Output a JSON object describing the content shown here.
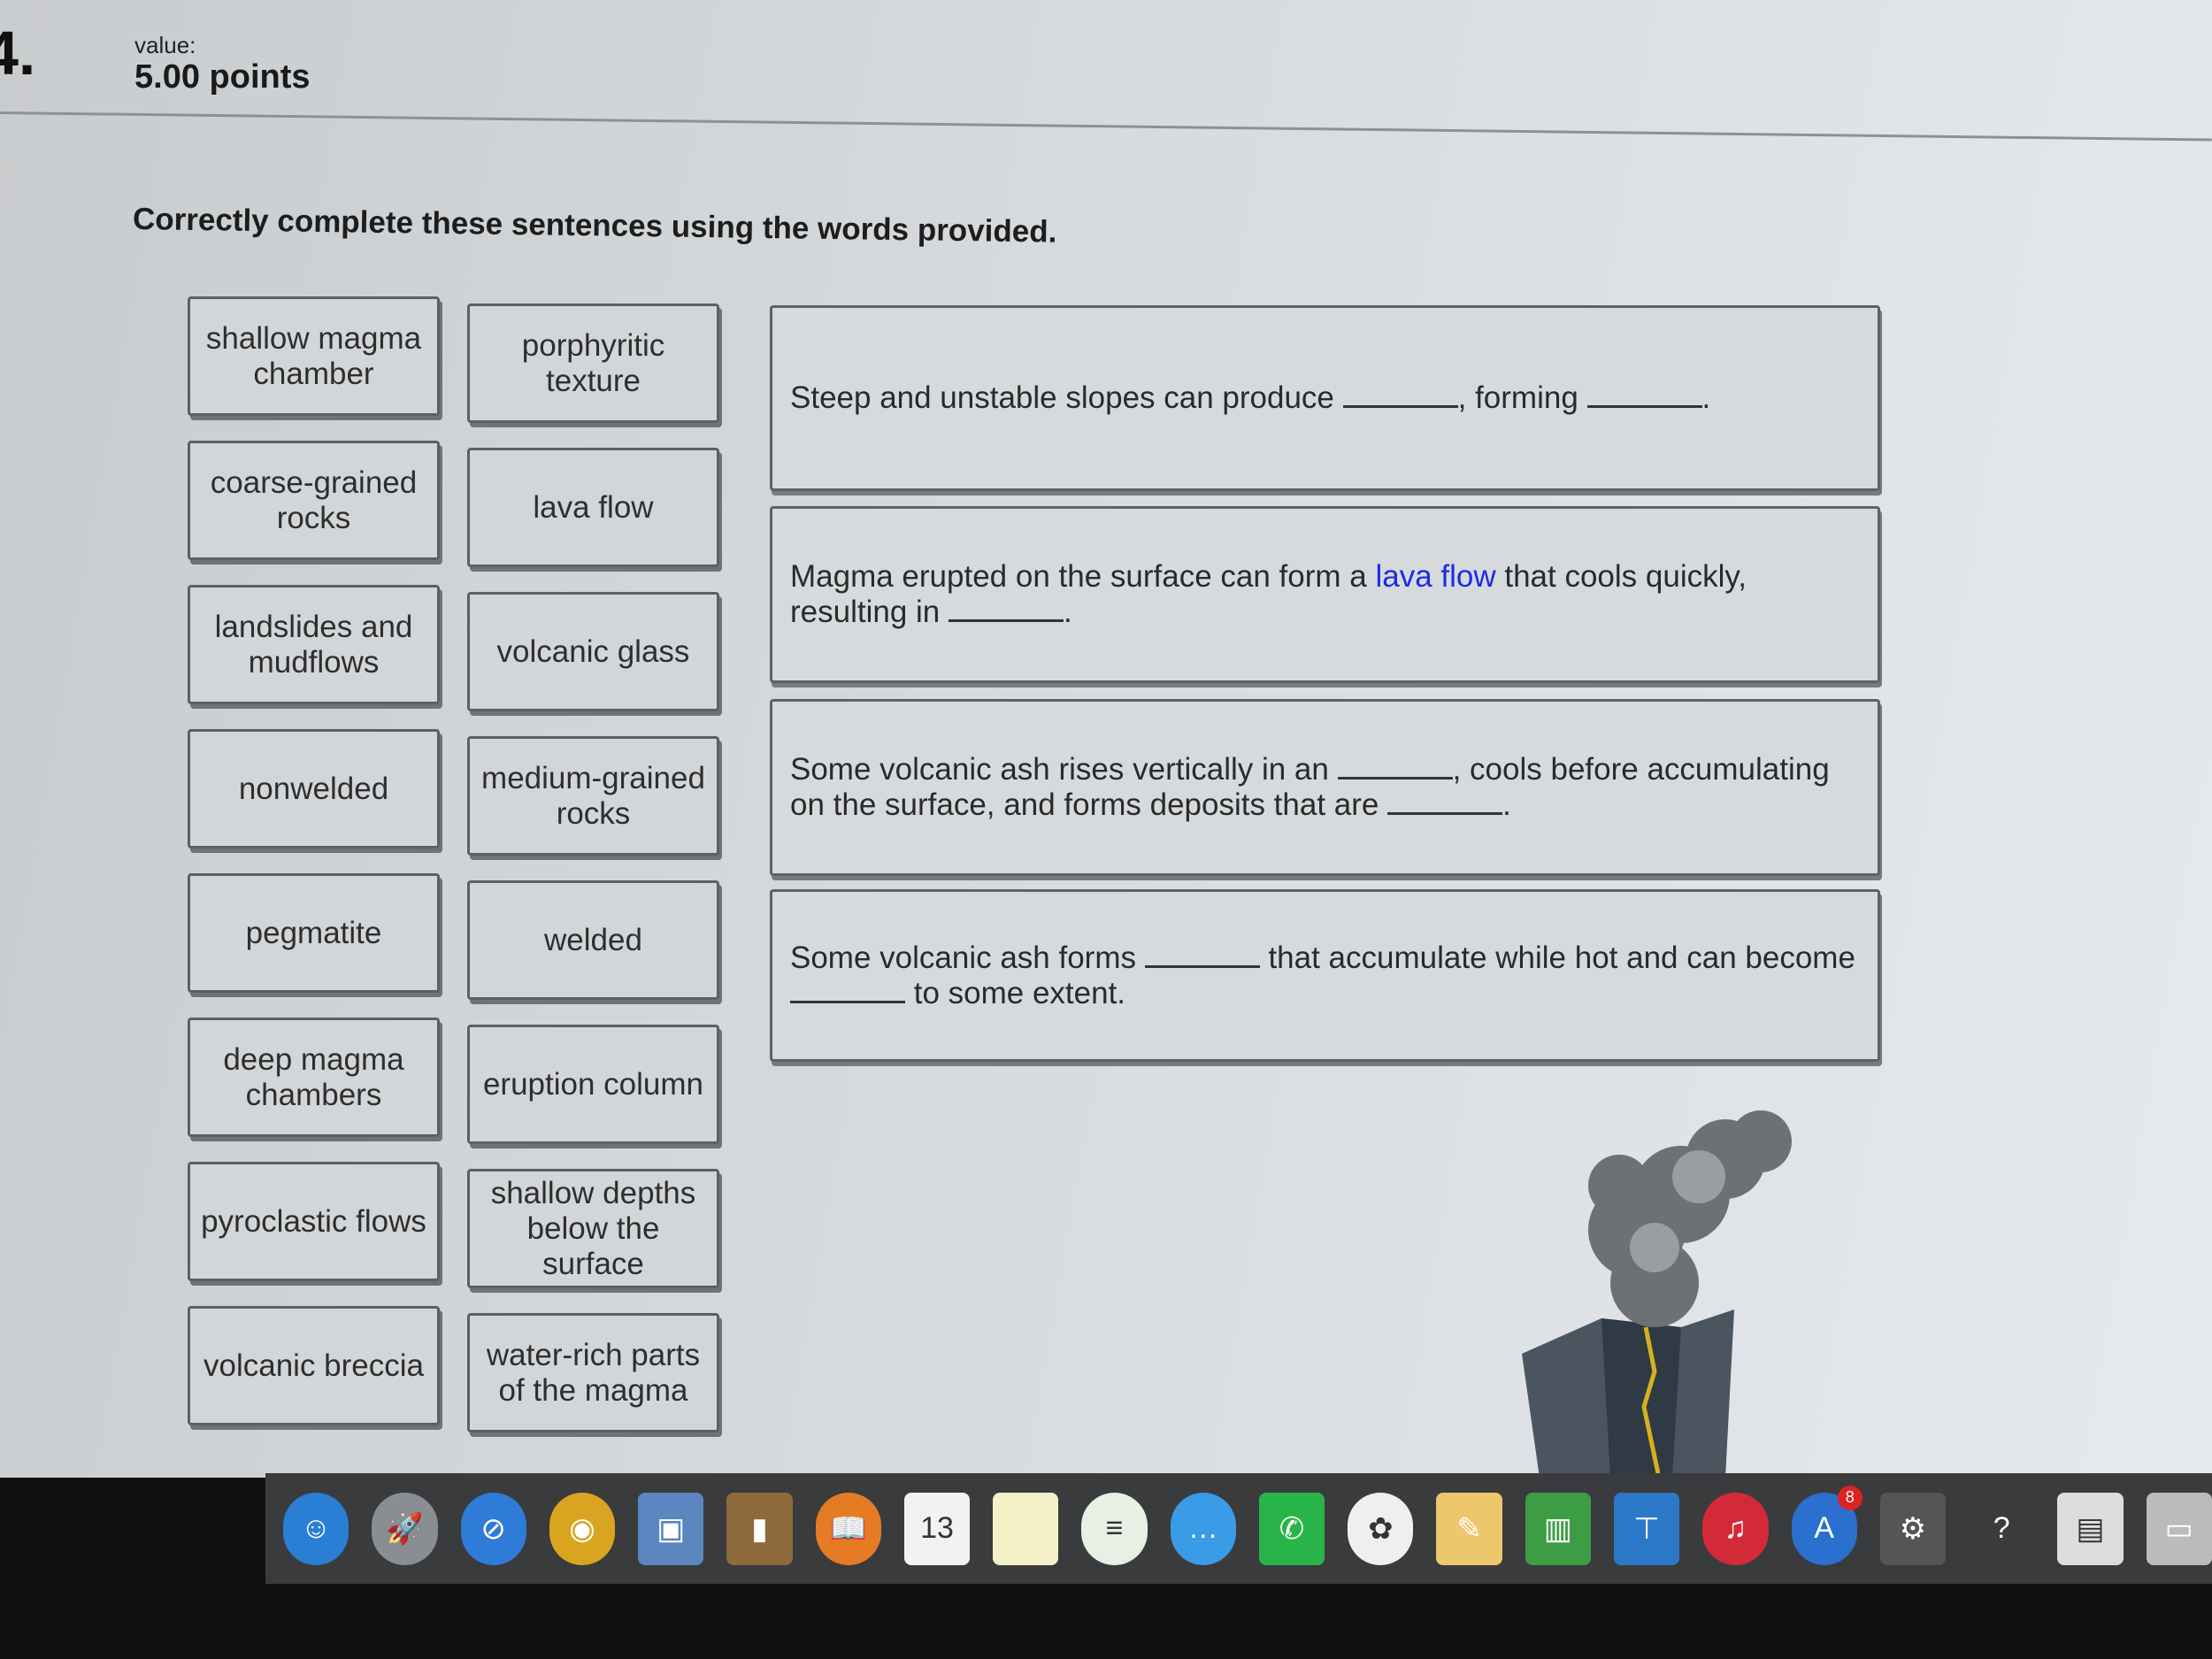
{
  "question": {
    "number": "4.",
    "value_label": "value:",
    "points": "5.00 points",
    "instructions": "Correctly complete these sentences using the words provided."
  },
  "word_bank": [
    "shallow magma chamber",
    "porphyritic texture",
    "coarse-grained rocks",
    "lava flow",
    "landslides and mudflows",
    "volcanic glass",
    "nonwelded",
    "medium-grained rocks",
    "pegmatite",
    "welded",
    "deep magma chambers",
    "eruption column",
    "pyroclastic flows",
    "shallow depths below the surface",
    "volcanic breccia",
    "water-rich parts of the magma"
  ],
  "sentences": [
    [
      {
        "t": "Steep and unstable slopes can produce "
      },
      {
        "blank": ""
      },
      {
        "t": ", forming "
      },
      {
        "blank": ""
      },
      {
        "t": "."
      }
    ],
    [
      {
        "t": "Magma erupted on the surface can form a "
      },
      {
        "filled": "lava flow"
      },
      {
        "t": " that cools quickly, resulting in "
      },
      {
        "blank": ""
      },
      {
        "t": "."
      }
    ],
    [
      {
        "t": "Some volcanic ash rises vertically in an "
      },
      {
        "blank": ""
      },
      {
        "t": ", cools before accumulating on the surface, and forms deposits that are "
      },
      {
        "blank": ""
      },
      {
        "t": "."
      }
    ],
    [
      {
        "t": "Some volcanic ash forms "
      },
      {
        "blank": ""
      },
      {
        "t": " that accumulate while hot and can become "
      },
      {
        "blank": ""
      },
      {
        "t": " to some extent."
      }
    ]
  ],
  "dock": {
    "apps": [
      {
        "name": "finder",
        "color": "#2a7fd4",
        "glyph": "☺"
      },
      {
        "name": "launchpad",
        "color": "#8a8d91",
        "glyph": "🚀"
      },
      {
        "name": "safari",
        "color": "#2f7bd8",
        "glyph": "⊘"
      },
      {
        "name": "chrome",
        "color": "#d9a520",
        "glyph": "◉"
      },
      {
        "name": "preview",
        "color": "#5b86c0",
        "glyph": "▣"
      },
      {
        "name": "contacts",
        "color": "#8c6a3c",
        "glyph": "▮"
      },
      {
        "name": "ibooks",
        "color": "#e57b24",
        "glyph": "📖"
      },
      {
        "name": "calendar",
        "color": "#f2f2f2",
        "glyph": "13"
      },
      {
        "name": "notes",
        "color": "#f4f0c8",
        "glyph": ""
      },
      {
        "name": "reminders",
        "color": "#e8efe4",
        "glyph": "≡"
      },
      {
        "name": "messages",
        "color": "#3a9be6",
        "glyph": "…"
      },
      {
        "name": "facetime",
        "color": "#29b44a",
        "glyph": "✆"
      },
      {
        "name": "photos",
        "color": "#efefef",
        "glyph": "✿"
      },
      {
        "name": "pages",
        "color": "#eec66b",
        "glyph": "✎"
      },
      {
        "name": "numbers",
        "color": "#3c9d45",
        "glyph": "▥"
      },
      {
        "name": "keynote",
        "color": "#2c78c8",
        "glyph": "⊤"
      },
      {
        "name": "itunes",
        "color": "#d32a38",
        "glyph": "♫"
      },
      {
        "name": "app-store",
        "color": "#2b6fcf",
        "glyph": "A",
        "badge": "8"
      },
      {
        "name": "system-preferences",
        "color": "#555",
        "glyph": "⚙"
      },
      {
        "name": "help",
        "color": "#3a3b3c",
        "glyph": "?"
      },
      {
        "name": "document",
        "color": "#ddd",
        "glyph": "▤"
      },
      {
        "name": "downloads",
        "color": "#bbb",
        "glyph": "▭"
      }
    ]
  }
}
